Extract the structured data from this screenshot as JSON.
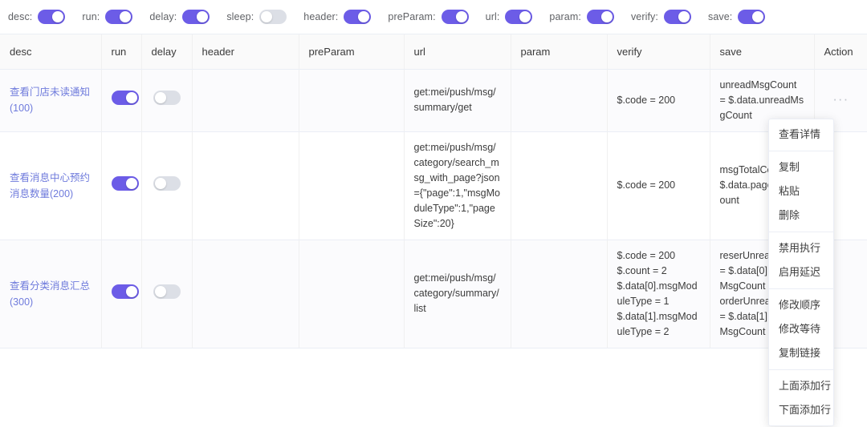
{
  "toolbar": {
    "toggles": [
      {
        "label": "desc:",
        "on": true
      },
      {
        "label": "run:",
        "on": true
      },
      {
        "label": "delay:",
        "on": true
      },
      {
        "label": "sleep:",
        "on": false
      },
      {
        "label": "header:",
        "on": true
      },
      {
        "label": "preParam:",
        "on": true
      },
      {
        "label": "url:",
        "on": true
      },
      {
        "label": "param:",
        "on": true
      },
      {
        "label": "verify:",
        "on": true
      },
      {
        "label": "save:",
        "on": true
      }
    ]
  },
  "table": {
    "columns": [
      {
        "key": "desc",
        "label": "desc"
      },
      {
        "key": "run",
        "label": "run"
      },
      {
        "key": "delay",
        "label": "delay"
      },
      {
        "key": "header",
        "label": "header"
      },
      {
        "key": "preParam",
        "label": "preParam"
      },
      {
        "key": "url",
        "label": "url"
      },
      {
        "key": "param",
        "label": "param"
      },
      {
        "key": "verify",
        "label": "verify"
      },
      {
        "key": "save",
        "label": "save"
      },
      {
        "key": "action",
        "label": "Action"
      }
    ],
    "rows": [
      {
        "desc": "查看门店未读通知(100)",
        "run": true,
        "delay": false,
        "header": "",
        "preParam": "",
        "url": "get:mei/push/msg/summary/get",
        "param": "",
        "verify": "$.code = 200",
        "save": "unreadMsgCount = $.data.unreadMsgCount",
        "action": "···"
      },
      {
        "desc": "查看消息中心预约消息数量(200)",
        "run": true,
        "delay": false,
        "header": "",
        "preParam": "",
        "url": "get:mei/push/msg/category/search_msg_with_page?json={\"page\":1,\"msgModuleType\":1,\"pageSize\":20}",
        "param": "",
        "verify": "$.code = 200",
        "save": "msgTotalCount = $.data.pageTotalCount",
        "action": ""
      },
      {
        "desc": "查看分类消息汇总(300)",
        "run": true,
        "delay": false,
        "header": "",
        "preParam": "",
        "url": "get:mei/push/msg/category/summary/list",
        "param": "",
        "verify": "$.code = 200\n$.count = 2\n$.data[0].msgModuleType = 1\n$.data[1].msgModuleType = 2",
        "save": "reserUnreadCount = $.data[0].unreadMsgCount\norderUnreadCount = $.data[1].unreadMsgCount",
        "action": ""
      }
    ]
  },
  "context_menu": {
    "groups": [
      {
        "items": [
          "查看详情"
        ]
      },
      {
        "items": [
          "复制",
          "粘贴",
          "删除"
        ]
      },
      {
        "items": [
          "禁用执行",
          "启用延迟"
        ]
      },
      {
        "items": [
          "修改顺序",
          "修改等待",
          "复制链接"
        ]
      },
      {
        "items": [
          "上面添加行",
          "下面添加行"
        ]
      }
    ]
  },
  "colors": {
    "accent": "#6c5ce7",
    "link": "#6f7bdc",
    "header_bg": "#fafafa",
    "border": "#ebeef5"
  }
}
